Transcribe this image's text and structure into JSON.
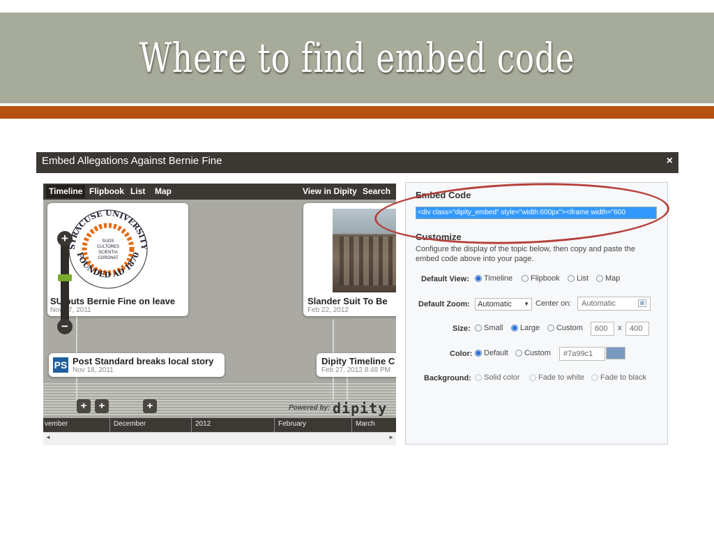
{
  "slide": {
    "title": "Where to find embed code",
    "colors": {
      "header_bg": "#a7ab99",
      "rule": "#b5520f",
      "annotation": "#b5403a"
    }
  },
  "dialog": {
    "title": "Embed Allegations Against Bernie Fine",
    "close_icon": "×"
  },
  "preview": {
    "nav_tabs": [
      "Timeline",
      "Flipbook",
      "List",
      "Map"
    ],
    "active_tab": "Timeline",
    "nav_links": [
      "View in Dipity",
      "Search"
    ],
    "seal_text": {
      "top": "SYRACUSE UNIVERSITY",
      "bottom": "FOUNDED AD 1870",
      "center": [
        "SUOS",
        "CULTORES",
        "SCIENTIA",
        "CORONAT"
      ]
    },
    "events": [
      {
        "title": "SU puts Bernie Fine on leave",
        "date": "Nov 17, 2011"
      },
      {
        "title": "Slander Suit To Be",
        "date": "Feb 22, 2012"
      },
      {
        "title": "Post Standard breaks local story",
        "date": "Nov 18, 2011"
      },
      {
        "title": "Dipity Timeline C",
        "date": "Feb 27, 2012 8:48 PM"
      }
    ],
    "zoom_in": "+",
    "zoom_out": "−",
    "add_buttons": [
      "+",
      "+",
      "+"
    ],
    "powered_by": "Powered by:",
    "brand": "dipity",
    "axis_labels": [
      "vember",
      "December",
      "2012",
      "February",
      "March"
    ],
    "scroll_left": "◄",
    "scroll_right": "►"
  },
  "embed": {
    "heading": "Embed Code",
    "code": "<div class=\"dipity_embed\" style=\"width:600px\"><iframe width=\"600"
  },
  "customize": {
    "heading": "Customize",
    "description": "Configure the display of the topic below, then copy and paste the embed code above into your page.",
    "default_view": {
      "label": "Default View:",
      "options": [
        "Timeline",
        "Flipbook",
        "List",
        "Map"
      ],
      "selected": "Timeline"
    },
    "default_zoom": {
      "label": "Default Zoom:",
      "value": "Automatic",
      "center_label": "Center on:",
      "center_value": "Automatic"
    },
    "size": {
      "label": "Size:",
      "options": [
        "Small",
        "Large",
        "Custom"
      ],
      "selected": "Large",
      "width": "600",
      "separator": "x",
      "height": "400"
    },
    "color": {
      "label": "Color:",
      "options": [
        "Default",
        "Custom"
      ],
      "selected": "Default",
      "value": "#7a99c1",
      "swatch": "#7a99c1"
    },
    "background": {
      "label": "Background:",
      "options": [
        "Solid color",
        "Fade to white",
        "Fade to black"
      ],
      "selected": "Solid color"
    }
  }
}
